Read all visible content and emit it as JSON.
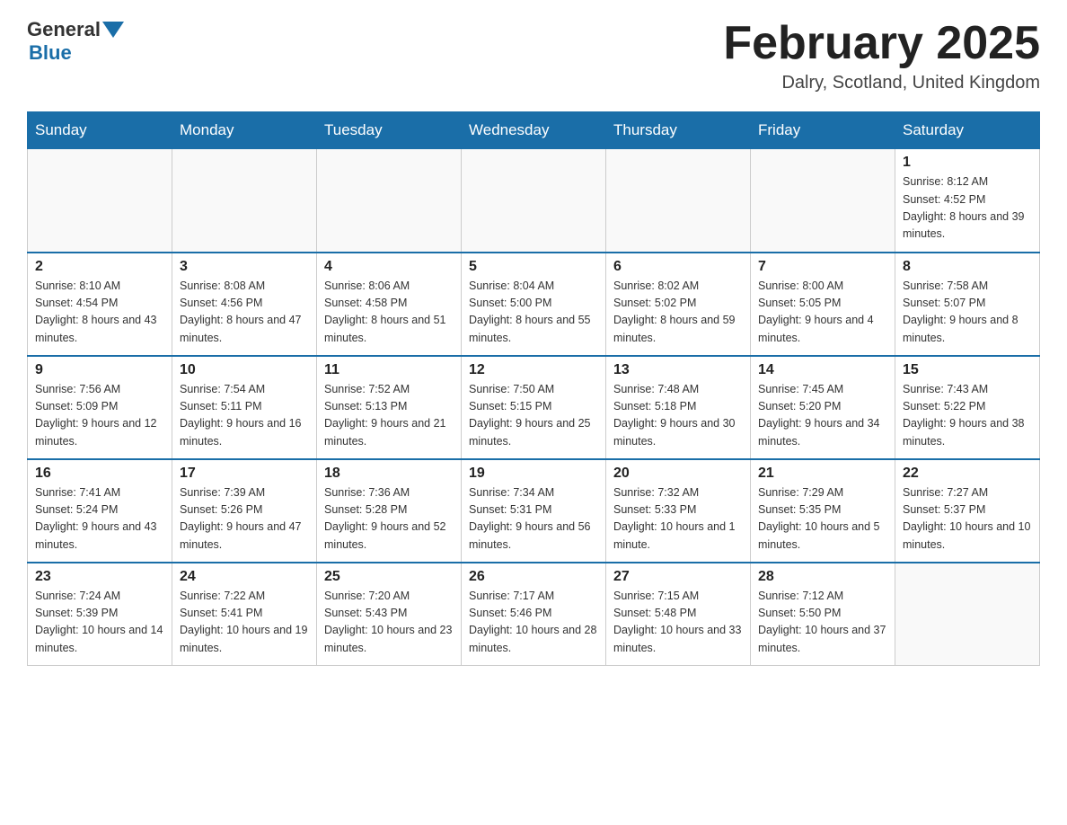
{
  "header": {
    "logo_general": "General",
    "logo_blue": "Blue",
    "month_title": "February 2025",
    "location": "Dalry, Scotland, United Kingdom"
  },
  "weekdays": [
    "Sunday",
    "Monday",
    "Tuesday",
    "Wednesday",
    "Thursday",
    "Friday",
    "Saturday"
  ],
  "weeks": [
    [
      {
        "day": "",
        "info": ""
      },
      {
        "day": "",
        "info": ""
      },
      {
        "day": "",
        "info": ""
      },
      {
        "day": "",
        "info": ""
      },
      {
        "day": "",
        "info": ""
      },
      {
        "day": "",
        "info": ""
      },
      {
        "day": "1",
        "info": "Sunrise: 8:12 AM\nSunset: 4:52 PM\nDaylight: 8 hours and 39 minutes."
      }
    ],
    [
      {
        "day": "2",
        "info": "Sunrise: 8:10 AM\nSunset: 4:54 PM\nDaylight: 8 hours and 43 minutes."
      },
      {
        "day": "3",
        "info": "Sunrise: 8:08 AM\nSunset: 4:56 PM\nDaylight: 8 hours and 47 minutes."
      },
      {
        "day": "4",
        "info": "Sunrise: 8:06 AM\nSunset: 4:58 PM\nDaylight: 8 hours and 51 minutes."
      },
      {
        "day": "5",
        "info": "Sunrise: 8:04 AM\nSunset: 5:00 PM\nDaylight: 8 hours and 55 minutes."
      },
      {
        "day": "6",
        "info": "Sunrise: 8:02 AM\nSunset: 5:02 PM\nDaylight: 8 hours and 59 minutes."
      },
      {
        "day": "7",
        "info": "Sunrise: 8:00 AM\nSunset: 5:05 PM\nDaylight: 9 hours and 4 minutes."
      },
      {
        "day": "8",
        "info": "Sunrise: 7:58 AM\nSunset: 5:07 PM\nDaylight: 9 hours and 8 minutes."
      }
    ],
    [
      {
        "day": "9",
        "info": "Sunrise: 7:56 AM\nSunset: 5:09 PM\nDaylight: 9 hours and 12 minutes."
      },
      {
        "day": "10",
        "info": "Sunrise: 7:54 AM\nSunset: 5:11 PM\nDaylight: 9 hours and 16 minutes."
      },
      {
        "day": "11",
        "info": "Sunrise: 7:52 AM\nSunset: 5:13 PM\nDaylight: 9 hours and 21 minutes."
      },
      {
        "day": "12",
        "info": "Sunrise: 7:50 AM\nSunset: 5:15 PM\nDaylight: 9 hours and 25 minutes."
      },
      {
        "day": "13",
        "info": "Sunrise: 7:48 AM\nSunset: 5:18 PM\nDaylight: 9 hours and 30 minutes."
      },
      {
        "day": "14",
        "info": "Sunrise: 7:45 AM\nSunset: 5:20 PM\nDaylight: 9 hours and 34 minutes."
      },
      {
        "day": "15",
        "info": "Sunrise: 7:43 AM\nSunset: 5:22 PM\nDaylight: 9 hours and 38 minutes."
      }
    ],
    [
      {
        "day": "16",
        "info": "Sunrise: 7:41 AM\nSunset: 5:24 PM\nDaylight: 9 hours and 43 minutes."
      },
      {
        "day": "17",
        "info": "Sunrise: 7:39 AM\nSunset: 5:26 PM\nDaylight: 9 hours and 47 minutes."
      },
      {
        "day": "18",
        "info": "Sunrise: 7:36 AM\nSunset: 5:28 PM\nDaylight: 9 hours and 52 minutes."
      },
      {
        "day": "19",
        "info": "Sunrise: 7:34 AM\nSunset: 5:31 PM\nDaylight: 9 hours and 56 minutes."
      },
      {
        "day": "20",
        "info": "Sunrise: 7:32 AM\nSunset: 5:33 PM\nDaylight: 10 hours and 1 minute."
      },
      {
        "day": "21",
        "info": "Sunrise: 7:29 AM\nSunset: 5:35 PM\nDaylight: 10 hours and 5 minutes."
      },
      {
        "day": "22",
        "info": "Sunrise: 7:27 AM\nSunset: 5:37 PM\nDaylight: 10 hours and 10 minutes."
      }
    ],
    [
      {
        "day": "23",
        "info": "Sunrise: 7:24 AM\nSunset: 5:39 PM\nDaylight: 10 hours and 14 minutes."
      },
      {
        "day": "24",
        "info": "Sunrise: 7:22 AM\nSunset: 5:41 PM\nDaylight: 10 hours and 19 minutes."
      },
      {
        "day": "25",
        "info": "Sunrise: 7:20 AM\nSunset: 5:43 PM\nDaylight: 10 hours and 23 minutes."
      },
      {
        "day": "26",
        "info": "Sunrise: 7:17 AM\nSunset: 5:46 PM\nDaylight: 10 hours and 28 minutes."
      },
      {
        "day": "27",
        "info": "Sunrise: 7:15 AM\nSunset: 5:48 PM\nDaylight: 10 hours and 33 minutes."
      },
      {
        "day": "28",
        "info": "Sunrise: 7:12 AM\nSunset: 5:50 PM\nDaylight: 10 hours and 37 minutes."
      },
      {
        "day": "",
        "info": ""
      }
    ]
  ]
}
